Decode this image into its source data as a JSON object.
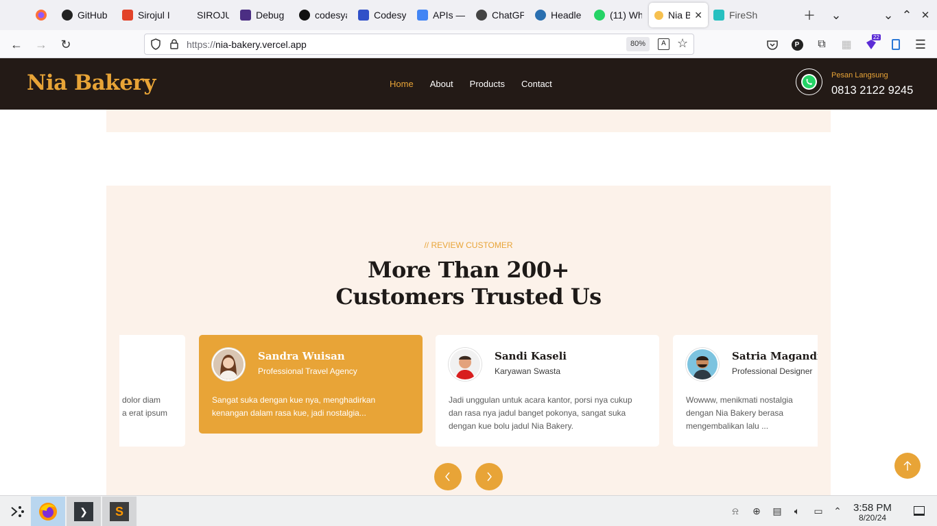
{
  "browser": {
    "tabs": [
      {
        "label": "GitHub",
        "icon": "github-icon",
        "color": "#222222"
      },
      {
        "label": "Sirojul I",
        "icon": "gitlab-icon",
        "color": "#e24329"
      },
      {
        "label": "SIROJUL M",
        "icon": "blank-page-icon",
        "color": "#f0f0f4"
      },
      {
        "label": "Debug",
        "icon": "debug-icon",
        "color": "#4b2e83"
      },
      {
        "label": "codesya",
        "icon": "codesy-icon",
        "color": "#111111"
      },
      {
        "label": "Codesy",
        "icon": "terminal-icon",
        "color": "#3050c8"
      },
      {
        "label": "APIs —",
        "icon": "google-cloud-icon",
        "color": "#4285f4"
      },
      {
        "label": "ChatGP",
        "icon": "openai-icon",
        "color": "#444444"
      },
      {
        "label": "Headle",
        "icon": "headless-icon",
        "color": "#2a6fb0"
      },
      {
        "label": "(11) Wh",
        "icon": "whatsapp-icon",
        "color": "#25d366"
      }
    ],
    "active_tab": {
      "label": "Nia B",
      "icon": "bread-icon"
    },
    "last_tab": {
      "label": "FireSho",
      "icon": "fireshot-icon"
    },
    "url_protocol": "https://",
    "url_host": "nia-bakery.vercel.app",
    "zoom": "80%"
  },
  "site": {
    "brand": "Nia Bakery",
    "menu": [
      "Home",
      "About",
      "Products",
      "Contact"
    ],
    "active_menu": "Home",
    "contact_label": "Pesan Langsung",
    "contact_phone": "0813 2122 9245",
    "accent_color": "#e8a437",
    "header_color": "#231a16"
  },
  "reviews": {
    "eyebrow": "// REVIEW CUSTOMER",
    "heading_line1": "More Than 200+",
    "heading_line2": "Customers Trusted Us",
    "partial_card_text": [
      "dolor diam",
      "a erat ipsum"
    ],
    "cards": [
      {
        "name": "Sandra Wuisan",
        "role": "Professional Travel Agency",
        "text": "Sangat suka dengan kue nya, menghadirkan kenangan dalam rasa kue, jadi nostalgia...",
        "highlighted": true
      },
      {
        "name": "Sandi Kaseli",
        "role": "Karyawan Swasta",
        "text": "Jadi unggulan untuk acara kantor, porsi nya cukup dan rasa nya jadul banget pokonya, sangat suka dengan kue bolu jadul Nia Bakery.",
        "highlighted": false
      },
      {
        "name": "Satria Magandi",
        "role": "Professional Designer",
        "text": "Wowww, menikmati nostalgia dengan Nia Bakery berasa mengembalikan lalu ...",
        "highlighted": false
      }
    ]
  },
  "taskbar": {
    "time": "3:58 PM",
    "date": "8/20/24",
    "badge": "22"
  }
}
